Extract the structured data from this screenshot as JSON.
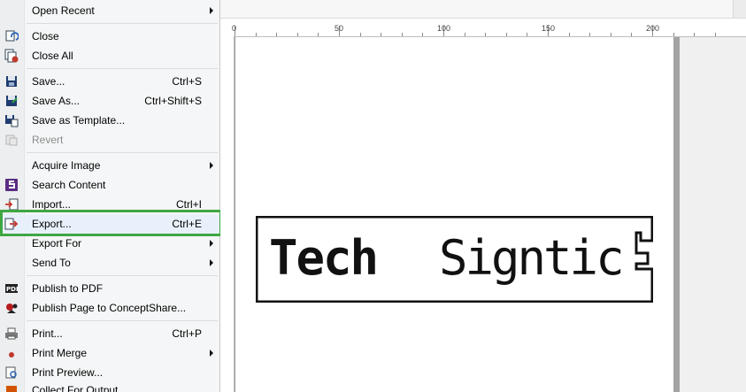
{
  "menu": {
    "items": [
      {
        "label": "Open Recent",
        "shortcut": "",
        "submenu": true,
        "icon": "none"
      },
      {
        "label": "Close",
        "shortcut": "",
        "submenu": false,
        "icon": "close-document-icon"
      },
      {
        "label": "Close All",
        "shortcut": "",
        "submenu": false,
        "icon": "close-all-icon"
      },
      {
        "label": "Save...",
        "shortcut": "Ctrl+S",
        "submenu": false,
        "icon": "save-icon"
      },
      {
        "label": "Save As...",
        "shortcut": "Ctrl+Shift+S",
        "submenu": false,
        "icon": "save-as-icon"
      },
      {
        "label": "Save as Template...",
        "shortcut": "",
        "submenu": false,
        "icon": "save-template-icon"
      },
      {
        "label": "Revert",
        "shortcut": "",
        "submenu": false,
        "icon": "revert-icon"
      },
      {
        "label": "Acquire Image",
        "shortcut": "",
        "submenu": true,
        "icon": "none"
      },
      {
        "label": "Search Content",
        "shortcut": "",
        "submenu": false,
        "icon": "search-content-icon"
      },
      {
        "label": "Import...",
        "shortcut": "Ctrl+I",
        "submenu": false,
        "icon": "import-icon"
      },
      {
        "label": "Export...",
        "shortcut": "Ctrl+E",
        "submenu": false,
        "icon": "export-icon"
      },
      {
        "label": "Export For",
        "shortcut": "",
        "submenu": true,
        "icon": "none"
      },
      {
        "label": "Send To",
        "shortcut": "",
        "submenu": true,
        "icon": "none"
      },
      {
        "label": "Publish to PDF",
        "shortcut": "",
        "submenu": false,
        "icon": "pdf-icon"
      },
      {
        "label": "Publish Page to ConceptShare...",
        "shortcut": "",
        "submenu": false,
        "icon": "conceptshare-icon"
      },
      {
        "label": "Print...",
        "shortcut": "Ctrl+P",
        "submenu": false,
        "icon": "printer-icon"
      },
      {
        "label": "Print Merge",
        "shortcut": "",
        "submenu": true,
        "icon": "none"
      },
      {
        "label": "Print Preview...",
        "shortcut": "",
        "submenu": false,
        "icon": "print-preview-icon"
      },
      {
        "label": "Collect For Output...",
        "shortcut": "",
        "submenu": false,
        "icon": "collect-output-icon"
      }
    ],
    "disabled_item": "Revert",
    "highlighted_item": "Export..."
  },
  "ruler": {
    "labels": [
      "0",
      "50",
      "100",
      "150",
      "200"
    ]
  },
  "logo": {
    "part1": "Tech",
    "part2": "Signtic"
  },
  "colors": {
    "focus_outline": "#3ea743",
    "highlight": "#e8f1fb"
  }
}
